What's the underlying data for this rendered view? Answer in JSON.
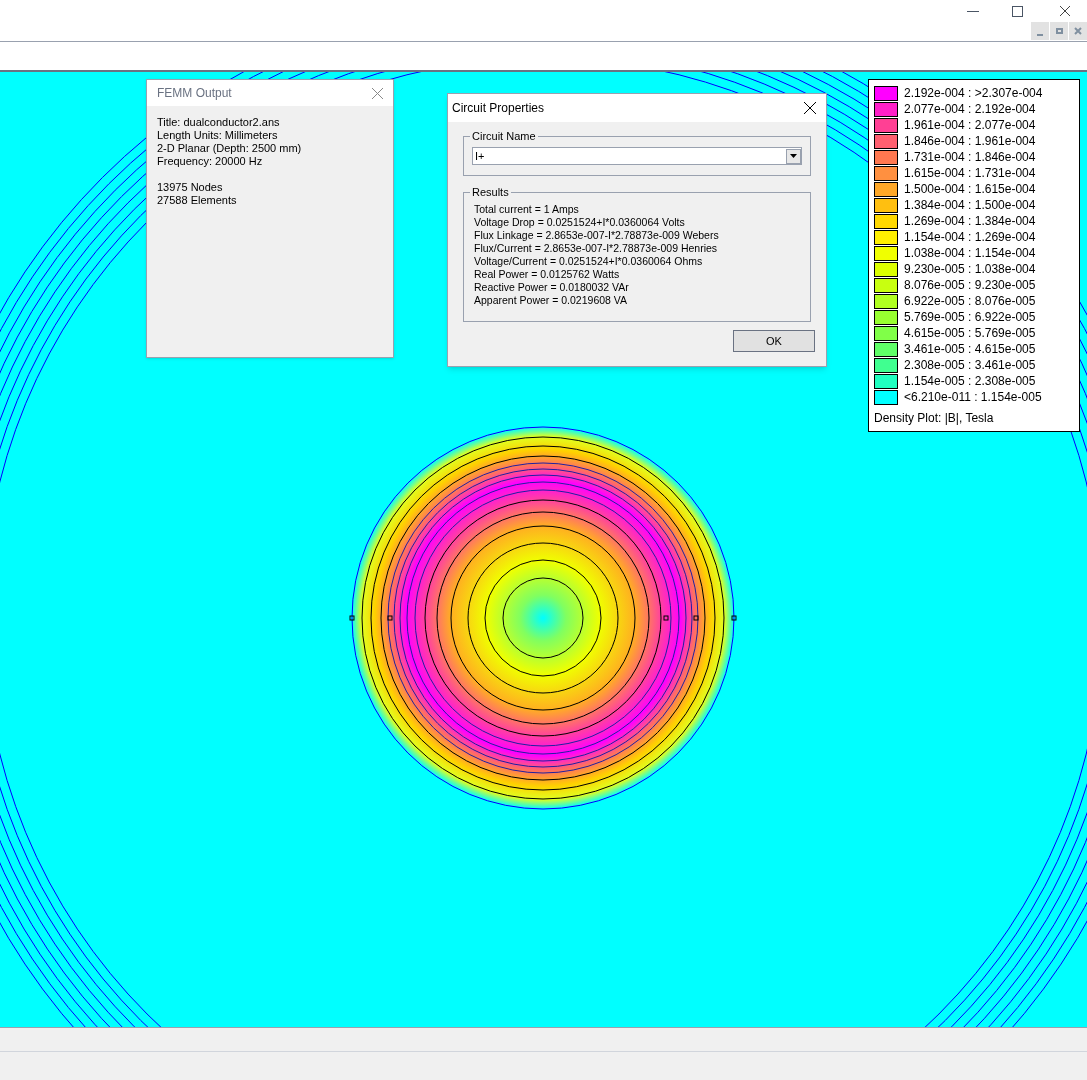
{
  "output_window": {
    "title": "FEMM Output",
    "lines": [
      "Title: dualconductor2.ans",
      "Length Units: Millimeters",
      "2-D Planar (Depth: 2500 mm)",
      "Frequency: 20000 Hz"
    ],
    "counts": [
      "13975 Nodes",
      "27588 Elements"
    ]
  },
  "circuit_dialog": {
    "title": "Circuit Properties",
    "name_group": "Circuit Name",
    "circuit_name": "I+",
    "results_group": "Results",
    "results": [
      "Total current = 1 Amps",
      "Voltage Drop = 0.0251524+I*0.0360064 Volts",
      "Flux Linkage = 2.8653e-007-I*2.78873e-009 Webers",
      "Flux/Current = 2.8653e-007-I*2.78873e-009 Henries",
      "Voltage/Current = 0.0251524+I*0.0360064 Ohms",
      "Real Power = 0.0125762 Watts",
      "Reactive Power = 0.0180032 VAr",
      "Apparent Power = 0.0219608 VA"
    ],
    "ok_button": "OK"
  },
  "legend": {
    "items": [
      {
        "label": "2.192e-004 : >2.307e-004",
        "color": "#ff00ff"
      },
      {
        "label": "2.077e-004 : 2.192e-004",
        "color": "#ff20c8"
      },
      {
        "label": "1.961e-004 : 2.077e-004",
        "color": "#ff4094"
      },
      {
        "label": "1.846e-004 : 1.961e-004",
        "color": "#ff6070"
      },
      {
        "label": "1.731e-004 : 1.846e-004",
        "color": "#ff7850"
      },
      {
        "label": "1.615e-004 : 1.731e-004",
        "color": "#ff9040"
      },
      {
        "label": "1.500e-004 : 1.615e-004",
        "color": "#ffa828"
      },
      {
        "label": "1.384e-004 : 1.500e-004",
        "color": "#ffbf10"
      },
      {
        "label": "1.269e-004 : 1.384e-004",
        "color": "#ffd800"
      },
      {
        "label": "1.154e-004 : 1.269e-004",
        "color": "#fff000"
      },
      {
        "label": "1.038e-004 : 1.154e-004",
        "color": "#f0ff00"
      },
      {
        "label": "9.230e-005 : 1.038e-004",
        "color": "#dcff00"
      },
      {
        "label": "8.076e-005 : 9.230e-005",
        "color": "#c8ff10"
      },
      {
        "label": "6.922e-005 : 8.076e-005",
        "color": "#b0ff20"
      },
      {
        "label": "5.769e-005 : 6.922e-005",
        "color": "#98ff30"
      },
      {
        "label": "4.615e-005 : 5.769e-005",
        "color": "#80ff48"
      },
      {
        "label": "3.461e-005 : 4.615e-005",
        "color": "#60ff68"
      },
      {
        "label": "2.308e-005 : 3.461e-005",
        "color": "#40ff90"
      },
      {
        "label": "1.154e-005 : 2.308e-005",
        "color": "#20ffc0"
      },
      {
        "label": "<6.210e-011 : 1.154e-005",
        "color": "#00ffff"
      }
    ],
    "caption": "Density Plot: |B|, Tesla"
  }
}
